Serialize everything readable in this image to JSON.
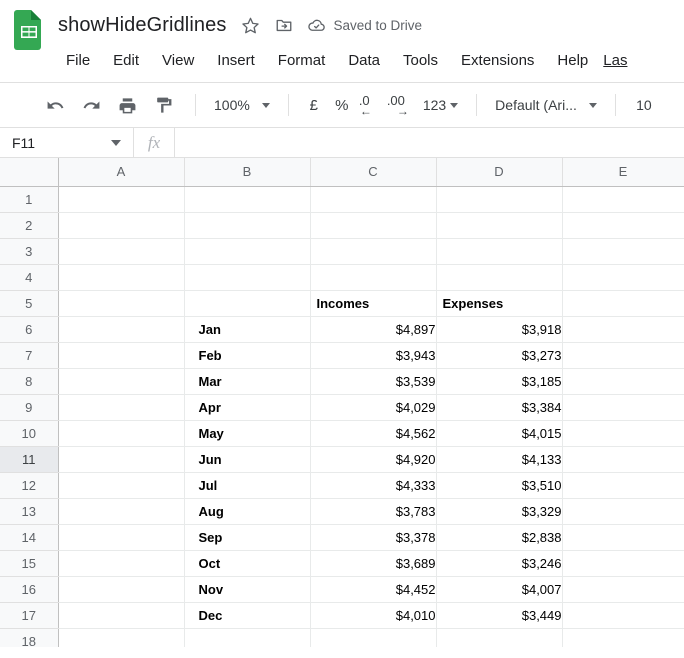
{
  "app": {
    "logo_icon": "google-sheets-logo",
    "doc_title": "showHideGridlines",
    "star_icon": "star-icon",
    "move_icon": "move-to-folder-icon",
    "cloud_icon": "cloud-saved-icon",
    "save_status": "Saved to Drive"
  },
  "menu": {
    "items": [
      {
        "label": "File"
      },
      {
        "label": "Edit"
      },
      {
        "label": "View"
      },
      {
        "label": "Insert"
      },
      {
        "label": "Format"
      },
      {
        "label": "Data"
      },
      {
        "label": "Tools"
      },
      {
        "label": "Extensions"
      },
      {
        "label": "Help"
      }
    ],
    "last_edit": "Las"
  },
  "toolbar": {
    "undo_icon": "undo-icon",
    "redo_icon": "redo-icon",
    "print_icon": "print-icon",
    "paint_icon": "paint-format-icon",
    "zoom_value": "100%",
    "currency_label": "£",
    "percent_label": "%",
    "decrease_decimal_num": ".0",
    "decrease_decimal_arrow": "←",
    "increase_decimal_num": ".00",
    "increase_decimal_arrow": "→",
    "number_format_label": "123",
    "font_name": "Default (Ari...",
    "font_size": "10"
  },
  "formula_bar": {
    "name_box_value": "F11",
    "fx_label": "fx",
    "formula_value": "",
    "formula_placeholder": ""
  },
  "grid": {
    "column_headers": [
      "A",
      "B",
      "C",
      "D",
      "E"
    ],
    "row_numbers": [
      "1",
      "2",
      "3",
      "4",
      "5",
      "6",
      "7",
      "8",
      "9",
      "10",
      "11",
      "12",
      "13",
      "14",
      "15",
      "16",
      "17",
      "18"
    ],
    "active_row": "11",
    "selected_cell": "F11",
    "table_header": {
      "incomes": "Incomes",
      "expenses": "Expenses"
    },
    "rows": [
      {
        "row": "1",
        "b": "",
        "c": "",
        "d": ""
      },
      {
        "row": "2",
        "b": "",
        "c": "",
        "d": ""
      },
      {
        "row": "3",
        "b": "",
        "c": "",
        "d": ""
      },
      {
        "row": "4",
        "b": "",
        "c": "",
        "d": ""
      },
      {
        "row": "5",
        "b": "",
        "c": "Incomes",
        "d": "Expenses"
      },
      {
        "row": "6",
        "b": "Jan",
        "c": "$4,897",
        "d": "$3,918"
      },
      {
        "row": "7",
        "b": "Feb",
        "c": "$3,943",
        "d": "$3,273"
      },
      {
        "row": "8",
        "b": "Mar",
        "c": "$3,539",
        "d": "$3,185"
      },
      {
        "row": "9",
        "b": "Apr",
        "c": "$4,029",
        "d": "$3,384"
      },
      {
        "row": "10",
        "b": "May",
        "c": "$4,562",
        "d": "$4,015"
      },
      {
        "row": "11",
        "b": "Jun",
        "c": "$4,920",
        "d": "$4,133"
      },
      {
        "row": "12",
        "b": "Jul",
        "c": "$4,333",
        "d": "$3,510"
      },
      {
        "row": "13",
        "b": "Aug",
        "c": "$3,783",
        "d": "$3,329"
      },
      {
        "row": "14",
        "b": "Sep",
        "c": "$3,378",
        "d": "$2,838"
      },
      {
        "row": "15",
        "b": "Oct",
        "c": "$3,689",
        "d": "$3,246"
      },
      {
        "row": "16",
        "b": "Nov",
        "c": "$4,452",
        "d": "$4,007"
      },
      {
        "row": "17",
        "b": "Dec",
        "c": "$4,010",
        "d": "$3,449"
      },
      {
        "row": "18",
        "b": "",
        "c": "",
        "d": ""
      }
    ]
  },
  "colors": {
    "brand_green": "#34a853",
    "header_bg": "#f8f9fa",
    "gridline": "#e8eaea",
    "text": "#202124",
    "muted_text": "#5f6368",
    "active_row_bg": "#e8eaed"
  }
}
